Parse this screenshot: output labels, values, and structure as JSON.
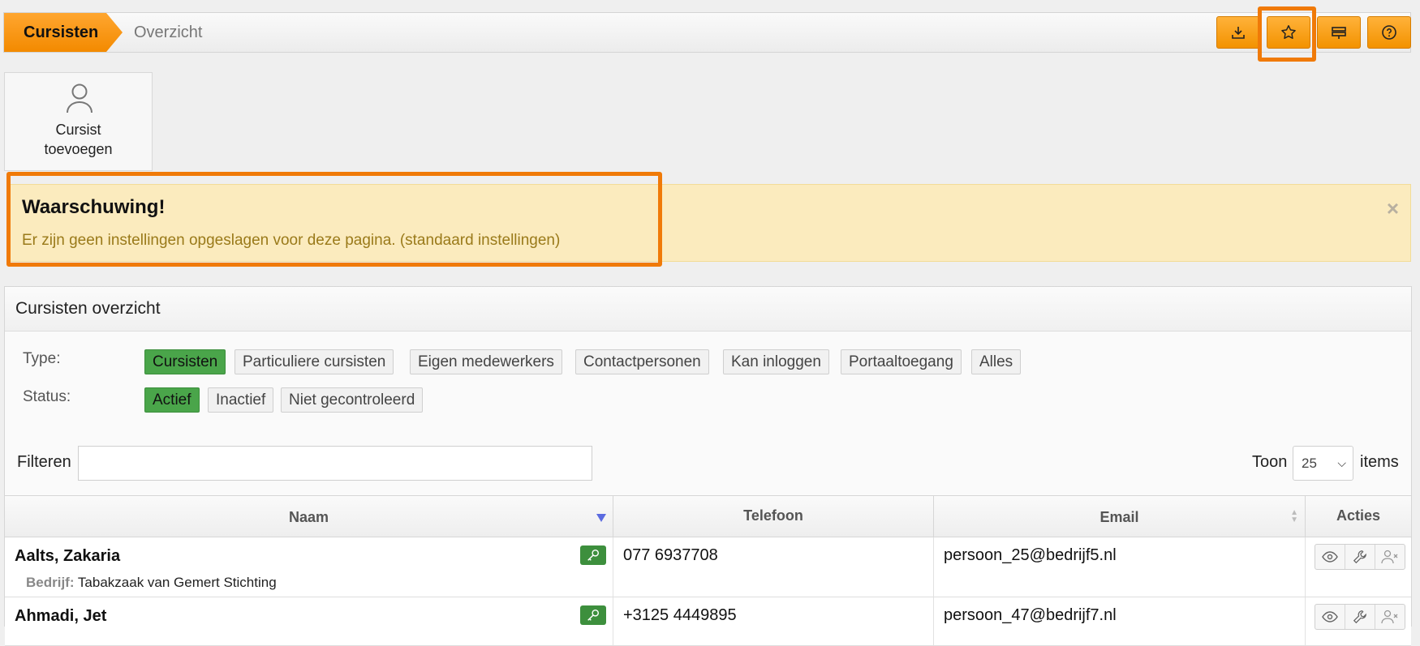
{
  "breadcrumb": {
    "active": "Cursisten",
    "current": "Overzicht"
  },
  "toolbar": {
    "buttons": [
      {
        "name": "download-icon"
      },
      {
        "name": "star-icon"
      },
      {
        "name": "columns-icon"
      },
      {
        "name": "help-icon"
      }
    ]
  },
  "add_card": {
    "line1": "Cursist",
    "line2": "toevoegen"
  },
  "warning": {
    "title": "Waarschuwing!",
    "message": "Er zijn geen instellingen opgeslagen voor deze pagina. (standaard instellingen)",
    "close": "×"
  },
  "panel": {
    "title": "Cursisten overzicht",
    "type_label": "Type:",
    "status_label": "Status:",
    "type_chips": [
      "Cursisten",
      "Particuliere cursisten",
      "Eigen medewerkers",
      "Contactpersonen",
      "Kan inloggen",
      "Portaaltoegang",
      "Alles"
    ],
    "status_chips": [
      "Actief",
      "Inactief",
      "Niet gecontroleerd"
    ],
    "filter_label": "Filteren",
    "filter_value": "",
    "show_label": "Toon",
    "show_value": "25",
    "items_label": "items"
  },
  "table": {
    "headers": {
      "naam": "Naam",
      "telefoon": "Telefoon",
      "email": "Email",
      "acties": "Acties"
    },
    "rows": [
      {
        "name": "Aalts, Zakaria",
        "company_label": "Bedrijf:",
        "company": "Tabakzaak van Gemert Stichting",
        "phone": "077 6937708",
        "email": "persoon_25@bedrijf5.nl"
      },
      {
        "name": "Ahmadi, Jet",
        "phone": "+3125 4449895",
        "email": "persoon_47@bedrijf7.nl"
      }
    ]
  },
  "colors": {
    "accent": "#f39200",
    "active_chip": "#4aa54a",
    "warning_bg": "#fbebbe"
  }
}
